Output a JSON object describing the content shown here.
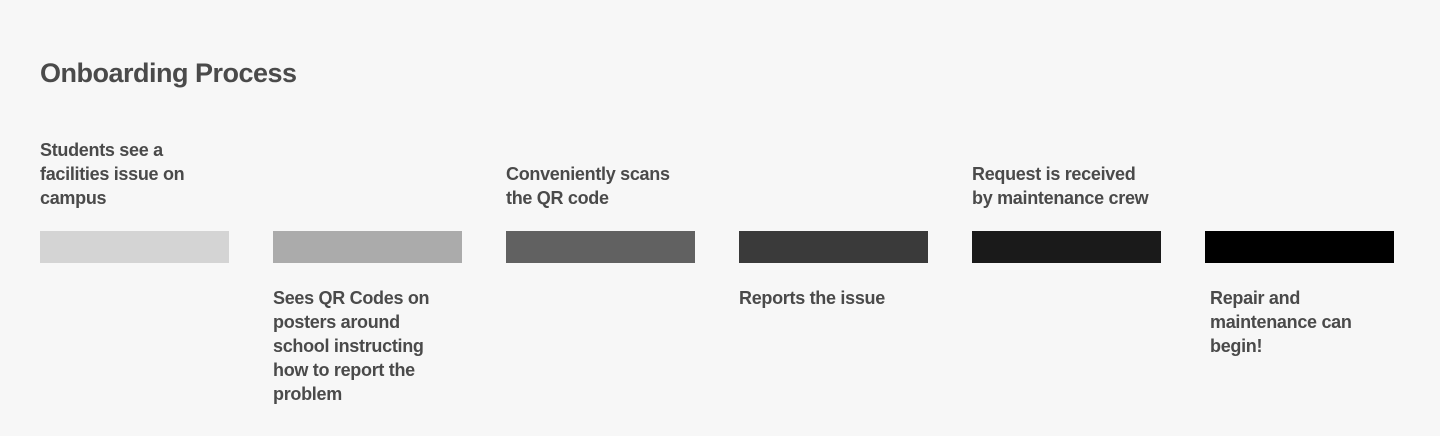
{
  "title": "Onboarding Process",
  "steps": [
    {
      "label": "Students see a\nfacilities issue on\ncampus",
      "position": "above",
      "color": "#d4d4d4"
    },
    {
      "label": "Sees QR Codes on\nposters around\nschool instructing\nhow to report the\nproblem",
      "position": "below",
      "color": "#ababab"
    },
    {
      "label": "Conveniently scans\nthe QR code",
      "position": "above",
      "color": "#616161"
    },
    {
      "label": "Reports the issue",
      "position": "below",
      "color": "#3a3a3a"
    },
    {
      "label": "Request is received\nby maintenance crew",
      "position": "above",
      "color": "#1a1a1a"
    },
    {
      "label": "Repair and\nmaintenance can\nbegin!",
      "position": "below",
      "color": "#000000"
    }
  ]
}
